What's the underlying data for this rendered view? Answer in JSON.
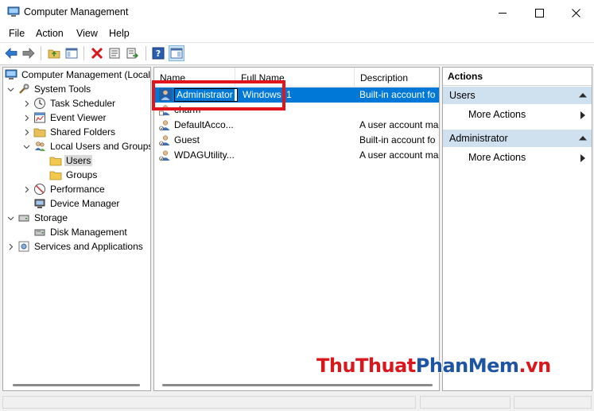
{
  "window": {
    "title": "Computer Management"
  },
  "menu": [
    "File",
    "Action",
    "View",
    "Help"
  ],
  "tree": {
    "items": [
      {
        "label": "Computer Management (Local",
        "level": 0,
        "expander": ""
      },
      {
        "label": "System Tools",
        "level": 1,
        "expander": "open"
      },
      {
        "label": "Task Scheduler",
        "level": 2,
        "expander": "closed"
      },
      {
        "label": "Event Viewer",
        "level": 2,
        "expander": "closed"
      },
      {
        "label": "Shared Folders",
        "level": 2,
        "expander": "closed"
      },
      {
        "label": "Local Users and Groups",
        "level": 2,
        "expander": "open"
      },
      {
        "label": "Users",
        "level": 3,
        "expander": "",
        "selected": true
      },
      {
        "label": "Groups",
        "level": 3,
        "expander": ""
      },
      {
        "label": "Performance",
        "level": 2,
        "expander": "closed"
      },
      {
        "label": "Device Manager",
        "level": 2,
        "expander": ""
      },
      {
        "label": "Storage",
        "level": 1,
        "expander": "open"
      },
      {
        "label": "Disk Management",
        "level": 2,
        "expander": ""
      },
      {
        "label": "Services and Applications",
        "level": 1,
        "expander": "closed"
      }
    ]
  },
  "list": {
    "columns": [
      "Name",
      "Full Name",
      "Description"
    ],
    "rows": [
      {
        "name": "Administrator",
        "full_name": "Windows",
        "full_name_tail": "1",
        "description": "Built-in account fo",
        "selected": true,
        "editing": true
      },
      {
        "name": "charm",
        "full_name": "",
        "description": ""
      },
      {
        "name": "DefaultAcco...",
        "full_name": "",
        "description": "A user account ma"
      },
      {
        "name": "Guest",
        "full_name": "",
        "description": "Built-in account fo"
      },
      {
        "name": "WDAGUtility...",
        "full_name": "",
        "description": "A user account ma"
      }
    ]
  },
  "actions": {
    "title": "Actions",
    "sections": [
      {
        "header": "Users",
        "items": [
          "More Actions"
        ]
      },
      {
        "header": "Administrator",
        "items": [
          "More Actions"
        ]
      }
    ]
  },
  "watermark": {
    "part1": "ThuThuat",
    "part2": "PhanMem",
    "part3": ".vn"
  },
  "colors": {
    "selection": "#0078d7",
    "section_header": "#cfe0ef",
    "highlight_box": "#e3141c",
    "watermark_red": "#d9171c",
    "watermark_blue": "#1d55a3"
  }
}
